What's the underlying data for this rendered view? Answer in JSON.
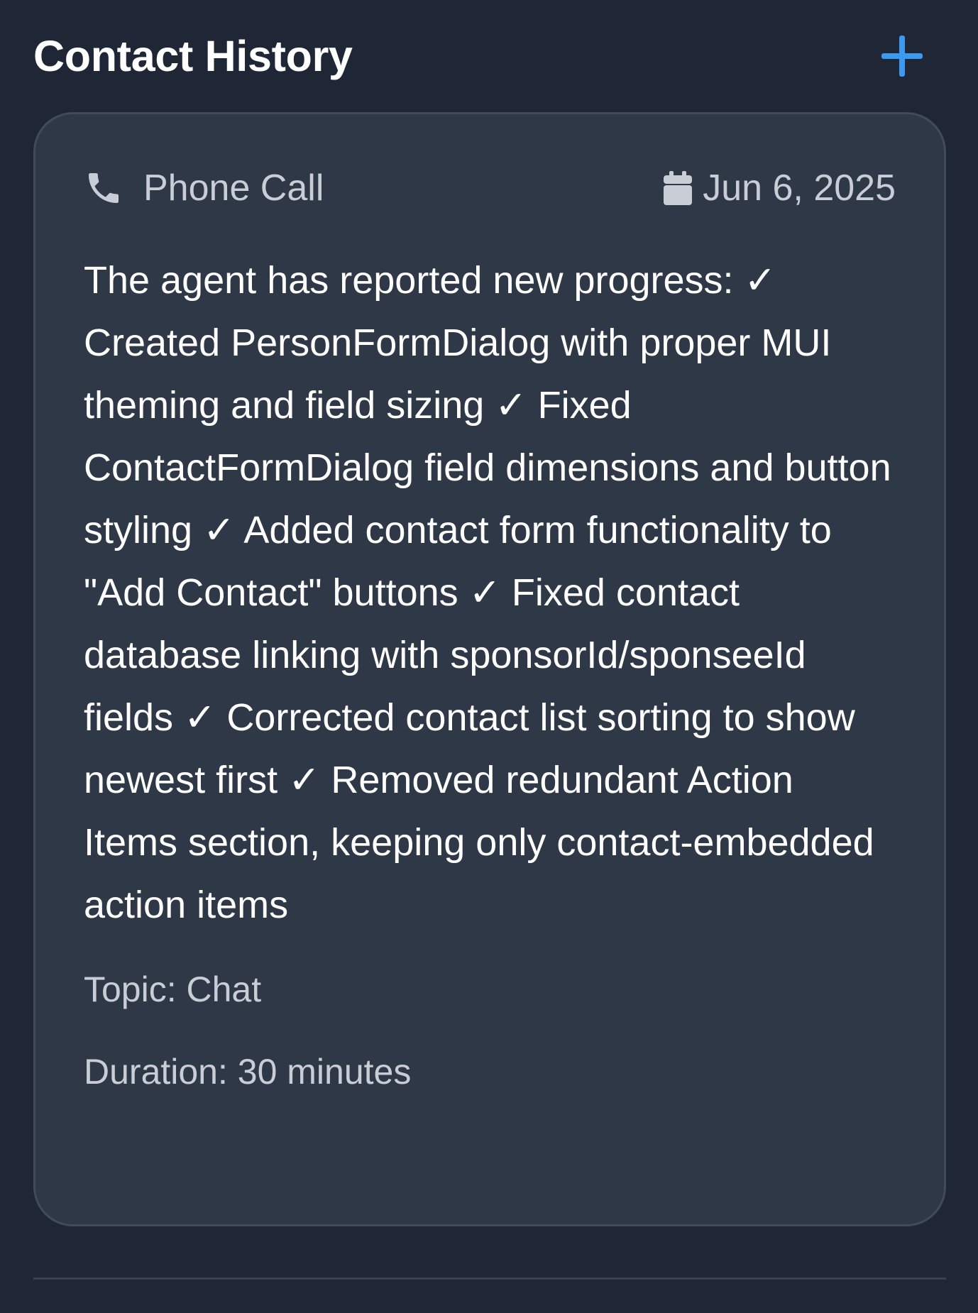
{
  "header": {
    "title": "Contact History",
    "add_icon": "plus-icon"
  },
  "contact": {
    "type_icon": "phone-icon",
    "type": "Phone Call",
    "date_icon": "calendar-icon",
    "date": "Jun 6, 2025",
    "notes": "The agent has reported new progress: ✓ Created PersonFormDialog with proper MUI theming and field sizing ✓ Fixed ContactFormDialog field dimensions and button styling ✓ Added contact form functionality to \"Add Contact\" buttons ✓ Fixed contact database linking with sponsorId/sponseeId fields ✓ Corrected contact list sorting to show newest first ✓ Removed redundant Action Items section, keeping only contact-embedded action items",
    "topic": "Topic: Chat",
    "duration": "Duration: 30 minutes"
  },
  "colors": {
    "background": "#1f2636",
    "card": "#2f3846",
    "accent": "#3b9af0",
    "text": "#ffffff",
    "muted": "#c9ced6"
  }
}
